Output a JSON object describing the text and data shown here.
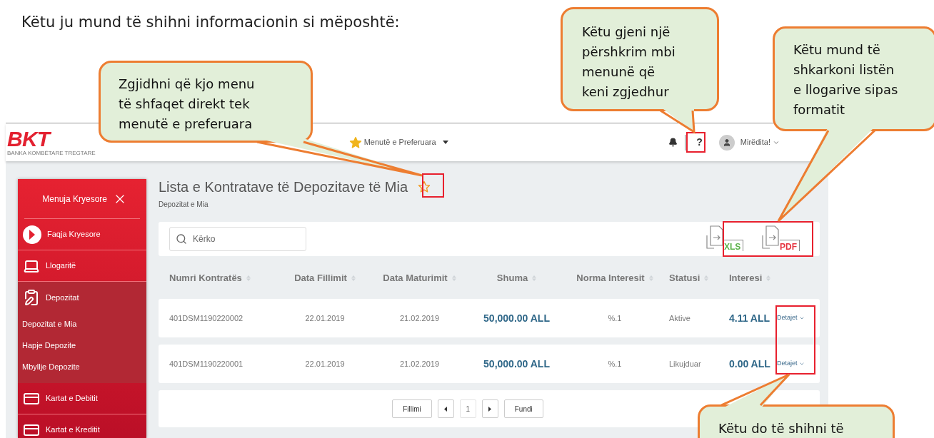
{
  "intro": "Këtu ju mund të shihni informacionin si mëposhtë:",
  "callouts": [
    {
      "text": "Zgjidhni që kjo menu\ntë shfaqet direkt tek\nmenutë e preferuara"
    },
    {
      "text": "Këtu gjeni një\npërshkrim mbi\nmenunë që\nkeni zgjedhur"
    },
    {
      "text": "Këtu mund të\nshkarkoni listën\ne llogarive sipas\nformatit"
    },
    {
      "text": "Këtu do të shihni të"
    }
  ],
  "header": {
    "logo": "BKT",
    "logo_caption": "BANKA KOMBËTARE TREGTARE",
    "favorites": "Menutë e Preferuara",
    "help": "?",
    "greeting": "Mirëdita!"
  },
  "sidebar": {
    "title": "Menuja Kryesore",
    "items": [
      {
        "label": "Faqja Kryesore",
        "kind": "home",
        "expanded": false
      },
      {
        "label": "Llogaritë",
        "kind": "accounts",
        "expanded": false
      },
      {
        "label": "Depozitat",
        "kind": "deposits",
        "expanded": true,
        "children": [
          {
            "label": "Depozitat e Mia"
          },
          {
            "label": "Hapje Depozite"
          },
          {
            "label": "Mbyllje Depozite"
          }
        ]
      },
      {
        "label": "Kartat e Debitit",
        "kind": "card",
        "expanded": false
      },
      {
        "label": "Kartat e Kreditit",
        "kind": "card",
        "expanded": false
      }
    ]
  },
  "page": {
    "title": "Lista e Kontratave të Depozitave të Mia",
    "favorite": false,
    "breadcrumb": "Depozitat e Mia",
    "search": {
      "placeholder": "Kërko"
    },
    "exports": [
      "XLS",
      "PDF"
    ]
  },
  "table": {
    "columns": [
      "Numri Kontratës",
      "Data Fillimit",
      "Data Maturimit",
      "Shuma",
      "Norma Interesit",
      "Statusi",
      "Interesi"
    ],
    "rows": [
      {
        "cells": [
          "401DSM1190220002",
          "22.01.2019",
          "21.02.2019",
          "50,000.00 ALL",
          "%.1",
          "Aktive",
          "4.11 ALL"
        ],
        "action": "Detajet"
      },
      {
        "cells": [
          "401DSM1190220001",
          "22.01.2019",
          "21.02.2019",
          "50,000.00 ALL",
          "%.1",
          "Likujduar",
          "0.00 ALL"
        ],
        "action": "Detajet"
      }
    ]
  },
  "pagination": {
    "first": "Fillimi",
    "page": "1",
    "last": "Fundi"
  }
}
